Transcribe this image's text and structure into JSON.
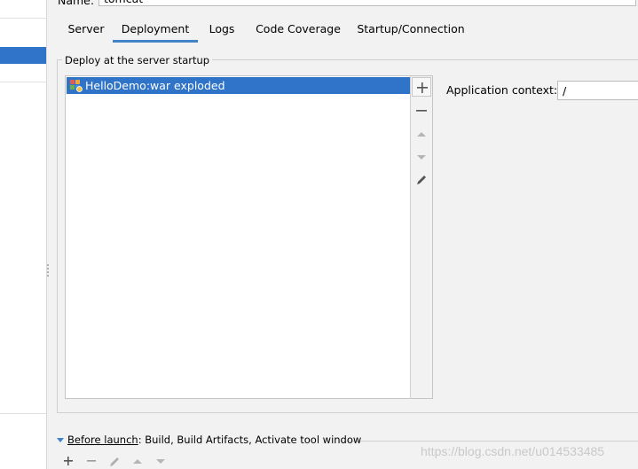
{
  "name_row": {
    "label": "Name:",
    "value": "tomcat"
  },
  "tabs": [
    {
      "label": "Server",
      "active": false
    },
    {
      "label": "Deployment",
      "active": true
    },
    {
      "label": "Logs",
      "active": false
    },
    {
      "label": "Code Coverage",
      "active": false
    },
    {
      "label": "Startup/Connection",
      "active": false
    }
  ],
  "deploy": {
    "group_title": "Deploy at the server startup",
    "items": [
      {
        "label": "HelloDemo:war exploded",
        "selected": true,
        "icon": "war-exploded-artifact-icon"
      }
    ],
    "toolbar": [
      "add-icon",
      "remove-icon",
      "move-up-icon",
      "move-down-icon",
      "edit-icon"
    ]
  },
  "application_context": {
    "label": "Application context:",
    "value": "/"
  },
  "before_launch": {
    "prefix": "Before launch",
    "text": ": Build, Build Artifacts, Activate tool window",
    "toolbar": [
      "add-icon",
      "remove-icon",
      "edit-icon",
      "move-up-icon",
      "move-down-icon"
    ]
  },
  "watermark": "https://blog.csdn.net/u014533485",
  "colors": {
    "accent": "#4083c9",
    "selection": "#2f74c9",
    "background": "#f2f2f2"
  }
}
